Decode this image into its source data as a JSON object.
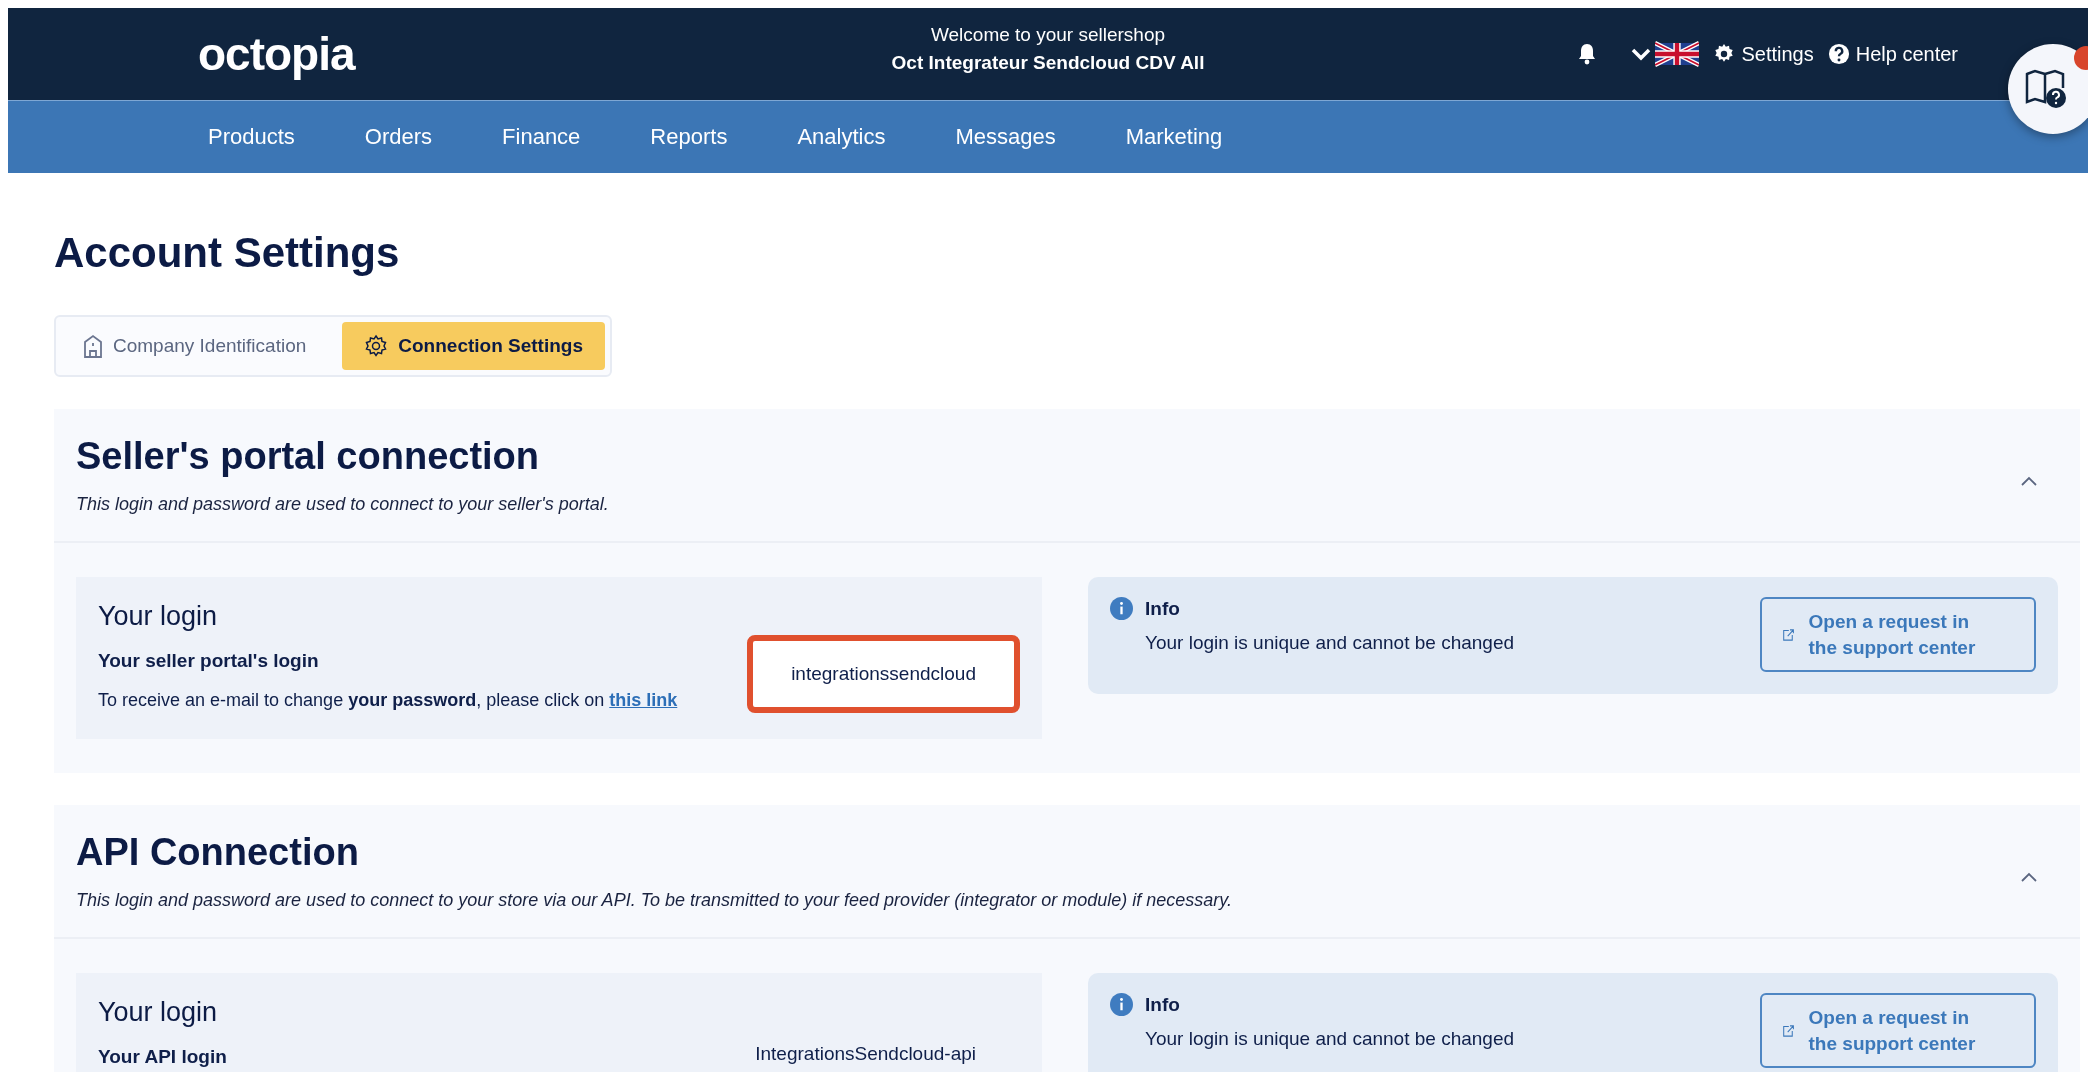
{
  "brand": {
    "logo": "octopia"
  },
  "header": {
    "welcome": "Welcome to your sellershop",
    "shop": "Oct Integrateur Sendcloud CDV All",
    "settings": "Settings",
    "help": "Help center"
  },
  "nav": [
    {
      "label": "Products"
    },
    {
      "label": "Orders"
    },
    {
      "label": "Finance"
    },
    {
      "label": "Reports"
    },
    {
      "label": "Analytics"
    },
    {
      "label": "Messages"
    },
    {
      "label": "Marketing"
    }
  ],
  "help_bubble": {
    "has_badge": true
  },
  "page_title": "Account Settings",
  "tabs": [
    {
      "label": "Company Identification",
      "selected": false,
      "kind": "building"
    },
    {
      "label": "Connection Settings",
      "selected": true,
      "kind": "gear"
    }
  ],
  "sections": [
    {
      "title": "Seller's portal connection",
      "description": "This login and password are used to connect to your seller's portal.",
      "expanded": true,
      "login": {
        "heading": "Your login",
        "label": "Your seller portal's login",
        "value": "integrationssendcloud",
        "highlighted": true,
        "note": "To receive an e-mail to change **your password**, please click on",
        "link": "this link"
      },
      "info": {
        "title": "Info",
        "text": "Your login is unique and cannot be changed",
        "button": "Open a request in the support center"
      }
    },
    {
      "title": "API Connection",
      "description": "This login and password are used to connect to your store via our API. To be transmitted to your feed provider (integrator or module) if necessary.",
      "expanded": true,
      "login": {
        "heading": "Your login",
        "label": "Your API login",
        "value": "IntegrationsSendcloud-api",
        "highlighted": false
      },
      "info": {
        "title": "Info",
        "text": "Your login is unique and cannot be changed",
        "button": "Open a request in the support center"
      }
    }
  ]
}
